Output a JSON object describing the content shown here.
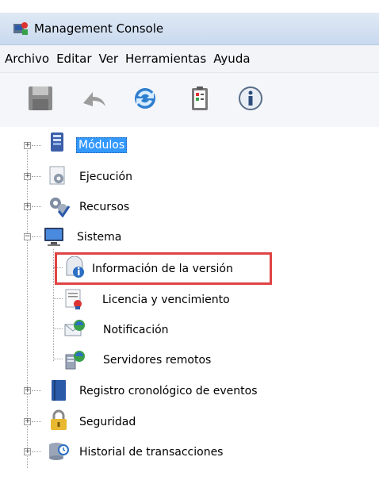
{
  "window": {
    "title": "Management Console"
  },
  "menu": [
    "Archivo",
    "Editar",
    "Ver",
    "Herramientas",
    "Ayuda"
  ],
  "toolbar": [
    {
      "icon": "save-icon",
      "enabled": false
    },
    {
      "icon": "undo-arrow-icon",
      "enabled": false
    },
    {
      "icon": "refresh-icon",
      "enabled": true
    },
    {
      "icon": "clipboard-report-icon",
      "enabled": true
    },
    {
      "icon": "info-icon",
      "enabled": true
    }
  ],
  "tree": {
    "modulos": "Módulos",
    "ejecucion": "Ejecución",
    "recursos": "Recursos",
    "sistema": "Sistema",
    "informacion_version": "Información de la versión",
    "licencia": "Licencia y vencimiento",
    "notificacion": "Notificación",
    "servidores_remotos": "Servidores remotos",
    "registro_eventos": "Registro cronológico de eventos",
    "seguridad": "Seguridad",
    "historial_transacciones": "Historial de transacciones",
    "selected": "Módulos",
    "highlighted": "Información de la versión"
  },
  "colors": {
    "selection": "#3399ff",
    "highlight": "#e04444"
  }
}
